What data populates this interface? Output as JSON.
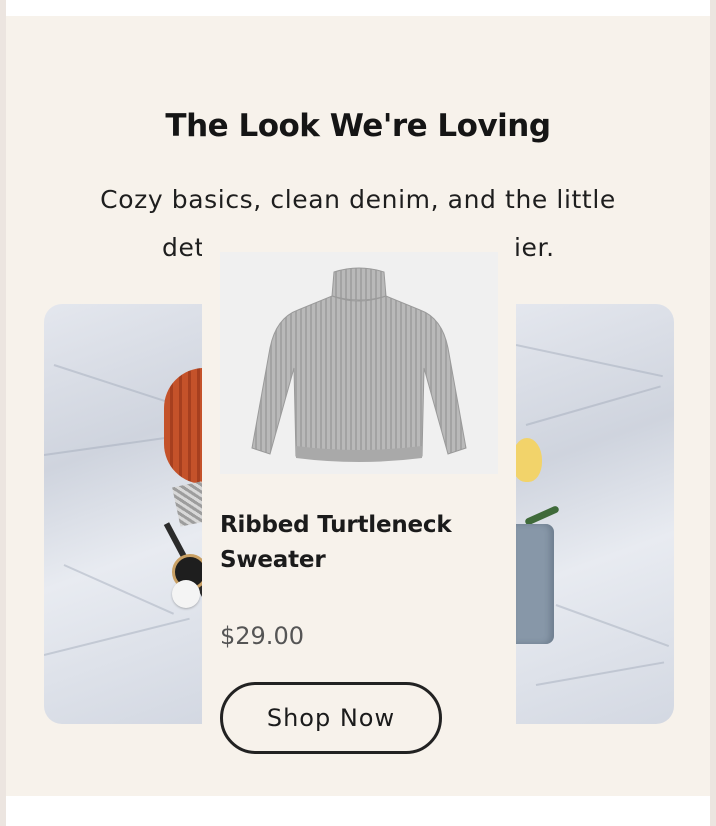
{
  "section": {
    "title": "The Look We're Loving",
    "subtitle_visible_left": "Cozy basics, clean denim, and the little",
    "subtitle_visible_right": "det",
    "subtitle_tail": "ier."
  },
  "featured_product": {
    "name": "Ribbed Turtleneck Sweater",
    "price": "$29.00",
    "cta_label": "Shop Now",
    "image_icon": "sweater-icon"
  },
  "colors": {
    "section_bg": "#f7f2eb",
    "text_primary": "#1b1b1b",
    "price_text": "#555555",
    "button_border": "#222222"
  }
}
